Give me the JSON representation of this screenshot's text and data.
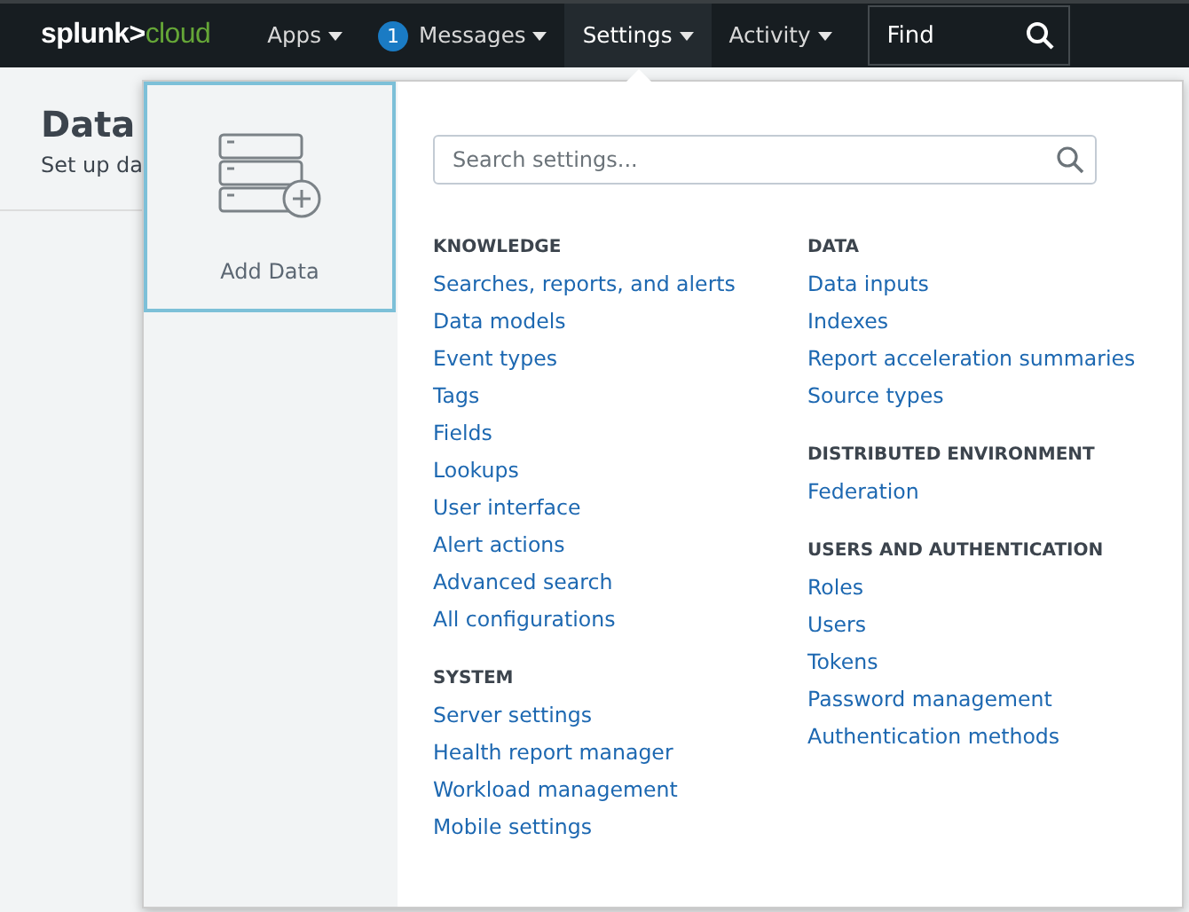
{
  "navbar": {
    "logo": {
      "brand": "splunk>",
      "product": "cloud"
    },
    "menus": [
      {
        "label": "Apps",
        "selected": false
      },
      {
        "label": "Messages",
        "badge": "1",
        "selected": false
      },
      {
        "label": "Settings",
        "selected": true
      },
      {
        "label": "Activity",
        "selected": false
      }
    ],
    "find": {
      "value": "Find"
    }
  },
  "page": {
    "title": "Data",
    "subtitle": "Set up da"
  },
  "settings_menu": {
    "tile": {
      "label": "Add Data"
    },
    "search": {
      "placeholder": "Search settings..."
    },
    "columns": [
      [
        {
          "heading": "KNOWLEDGE",
          "items": [
            "Searches, reports, and alerts",
            "Data models",
            "Event types",
            "Tags",
            "Fields",
            "Lookups",
            "User interface",
            "Alert actions",
            "Advanced search",
            "All configurations"
          ]
        },
        {
          "heading": "SYSTEM",
          "items": [
            "Server settings",
            "Health report manager",
            "Workload management",
            "Mobile settings"
          ]
        }
      ],
      [
        {
          "heading": "DATA",
          "items": [
            "Data inputs",
            "Indexes",
            "Report acceleration summaries",
            "Source types"
          ]
        },
        {
          "heading": "DISTRIBUTED ENVIRONMENT",
          "items": [
            "Federation"
          ]
        },
        {
          "heading": "USERS AND AUTHENTICATION",
          "items": [
            "Roles",
            "Users",
            "Tokens",
            "Password management",
            "Authentication methods"
          ]
        }
      ]
    ]
  }
}
